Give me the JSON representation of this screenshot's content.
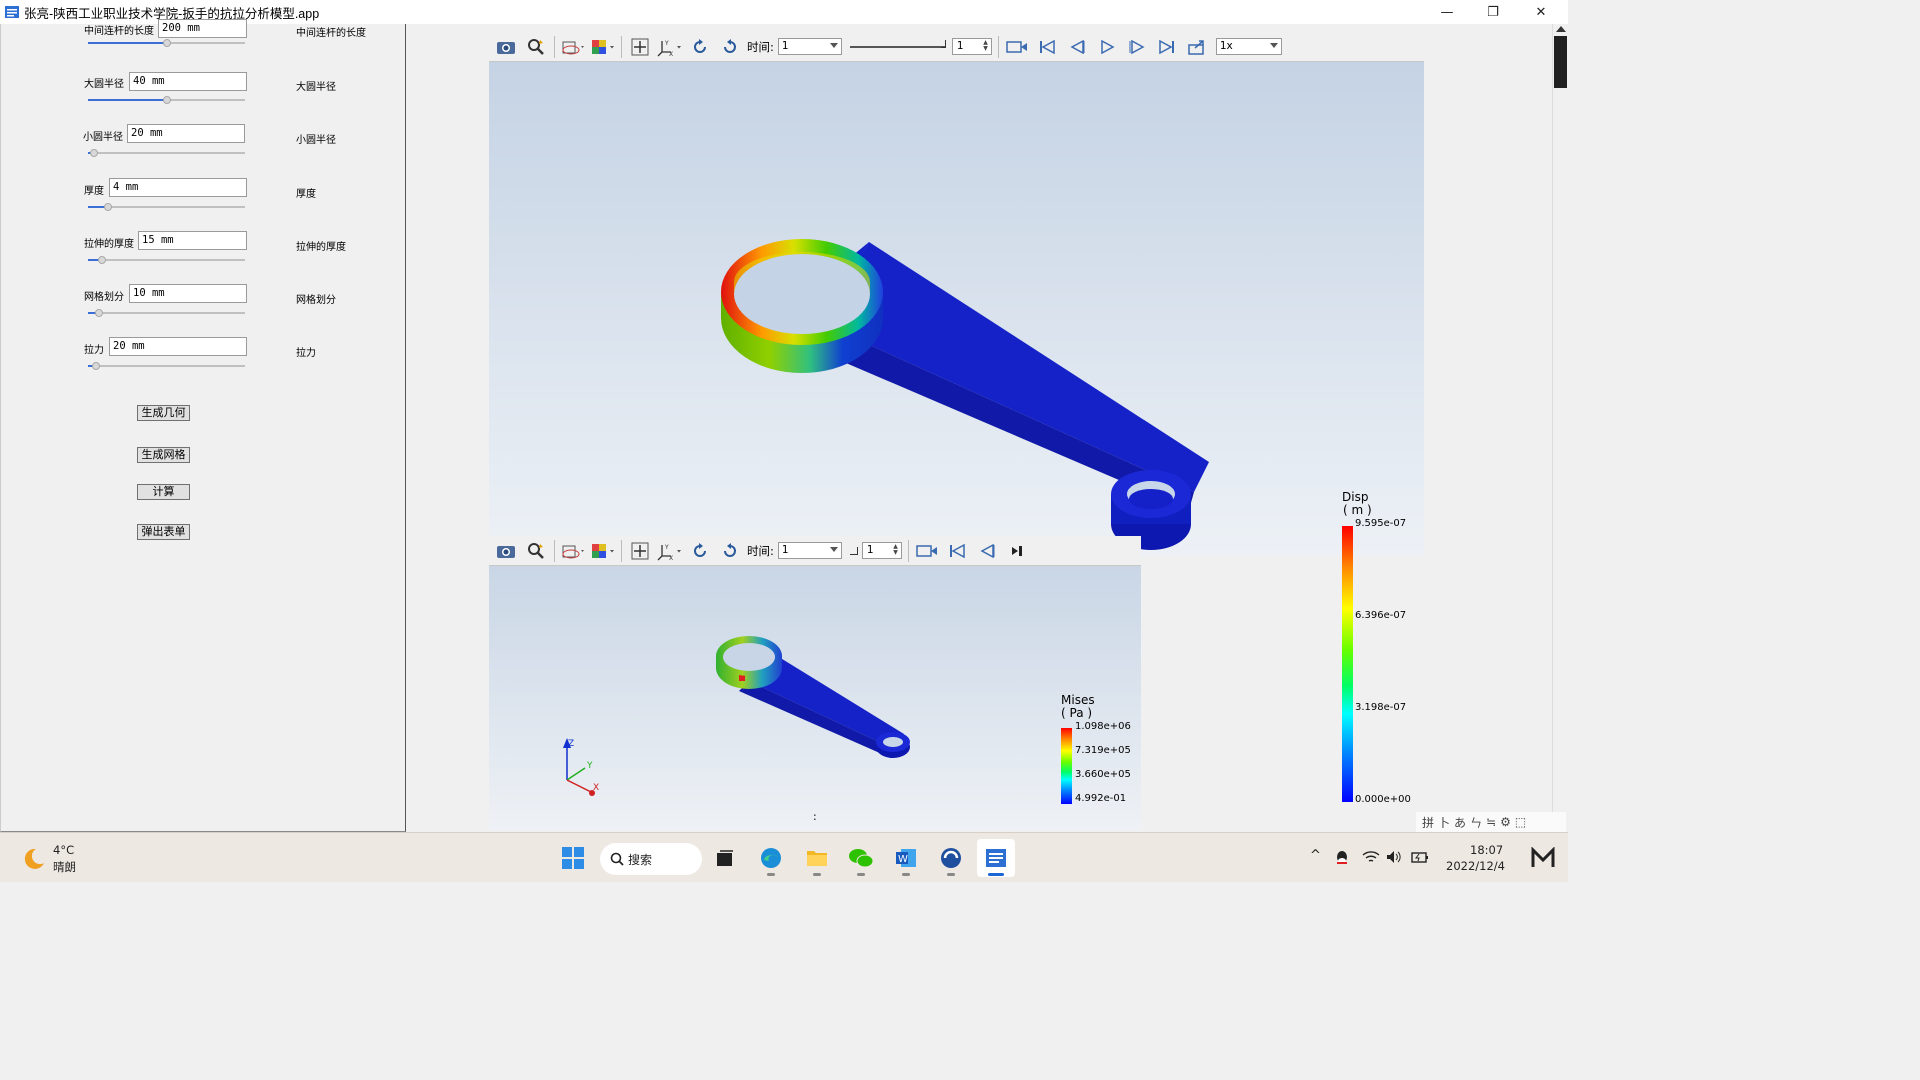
{
  "window": {
    "title": "张亮-陕西工业职业技术学院-扳手的抗拉分析模型.app",
    "minimize": "—",
    "restore": "❐",
    "close": "✕"
  },
  "params": [
    {
      "label": "中间连杆的长度",
      "value": "200 mm",
      "side": "中间连杆的长度",
      "fraction": 0.5
    },
    {
      "label": "大圆半径",
      "value": "40 mm",
      "side": "大圆半径",
      "fraction": 0.5
    },
    {
      "label": "小圆半径",
      "value": "20 mm",
      "side": "小圆半径",
      "fraction": 0.04
    },
    {
      "label": "厚度",
      "value": "4 mm",
      "side": "厚度",
      "fraction": 0.13
    },
    {
      "label": "拉伸的厚度",
      "value": "15 mm",
      "side": "拉伸的厚度",
      "fraction": 0.09
    },
    {
      "label": "网格划分",
      "value": "10 mm",
      "side": "网格划分",
      "fraction": 0.07
    },
    {
      "label": "拉力",
      "value": "20 mm",
      "side": "拉力",
      "fraction": 0.05
    }
  ],
  "buttons": {
    "gen_geometry": "生成几何",
    "gen_mesh": "生成网格",
    "compute": "计算",
    "popup_form": "弹出表单"
  },
  "viewer_top": {
    "time_label": "时间:",
    "time_value": "1",
    "frame_value": "1",
    "speed_value": "1x"
  },
  "viewer_bottom": {
    "time_label": "时间:",
    "time_value": "1",
    "frame_value": "1",
    "status_dots": ":"
  },
  "legend_disp": {
    "title": "Disp",
    "unit": "( m )",
    "ticks": [
      "9.595e-07",
      "6.396e-07",
      "3.198e-07",
      "0.000e+00"
    ]
  },
  "legend_mises": {
    "title": "Mises",
    "unit": "( Pa )",
    "ticks": [
      "1.098e+06",
      "7.319e+05",
      "3.660e+05",
      "4.992e-01"
    ]
  },
  "axes": {
    "x": "X",
    "y": "Y",
    "z": "Z"
  },
  "taskbar": {
    "weather_temp": "4°C",
    "weather_desc": "晴朗",
    "search_label": "搜索",
    "time": "18:07",
    "date": "2022/12/4"
  },
  "ime": {
    "items": [
      "拼",
      "卜",
      "あ",
      "ㄣ",
      "≒",
      "⚙",
      "⬚"
    ]
  },
  "colors": {
    "accent": "#3b6fd6",
    "viewport_top": "#c2d1e3",
    "taskbar": "#eee8e2",
    "mesh_blue": "#1420d0"
  },
  "icons": [
    "camera-icon",
    "zoom-icon",
    "clip-icon",
    "mesh-cube-icon",
    "fit-icon",
    "axis-icon",
    "rotate-icon",
    "reset-rotate-icon",
    "record-icon",
    "first-frame-icon",
    "prev-frame-icon",
    "play-icon",
    "next-frame-icon",
    "last-frame-icon",
    "export-icon"
  ]
}
